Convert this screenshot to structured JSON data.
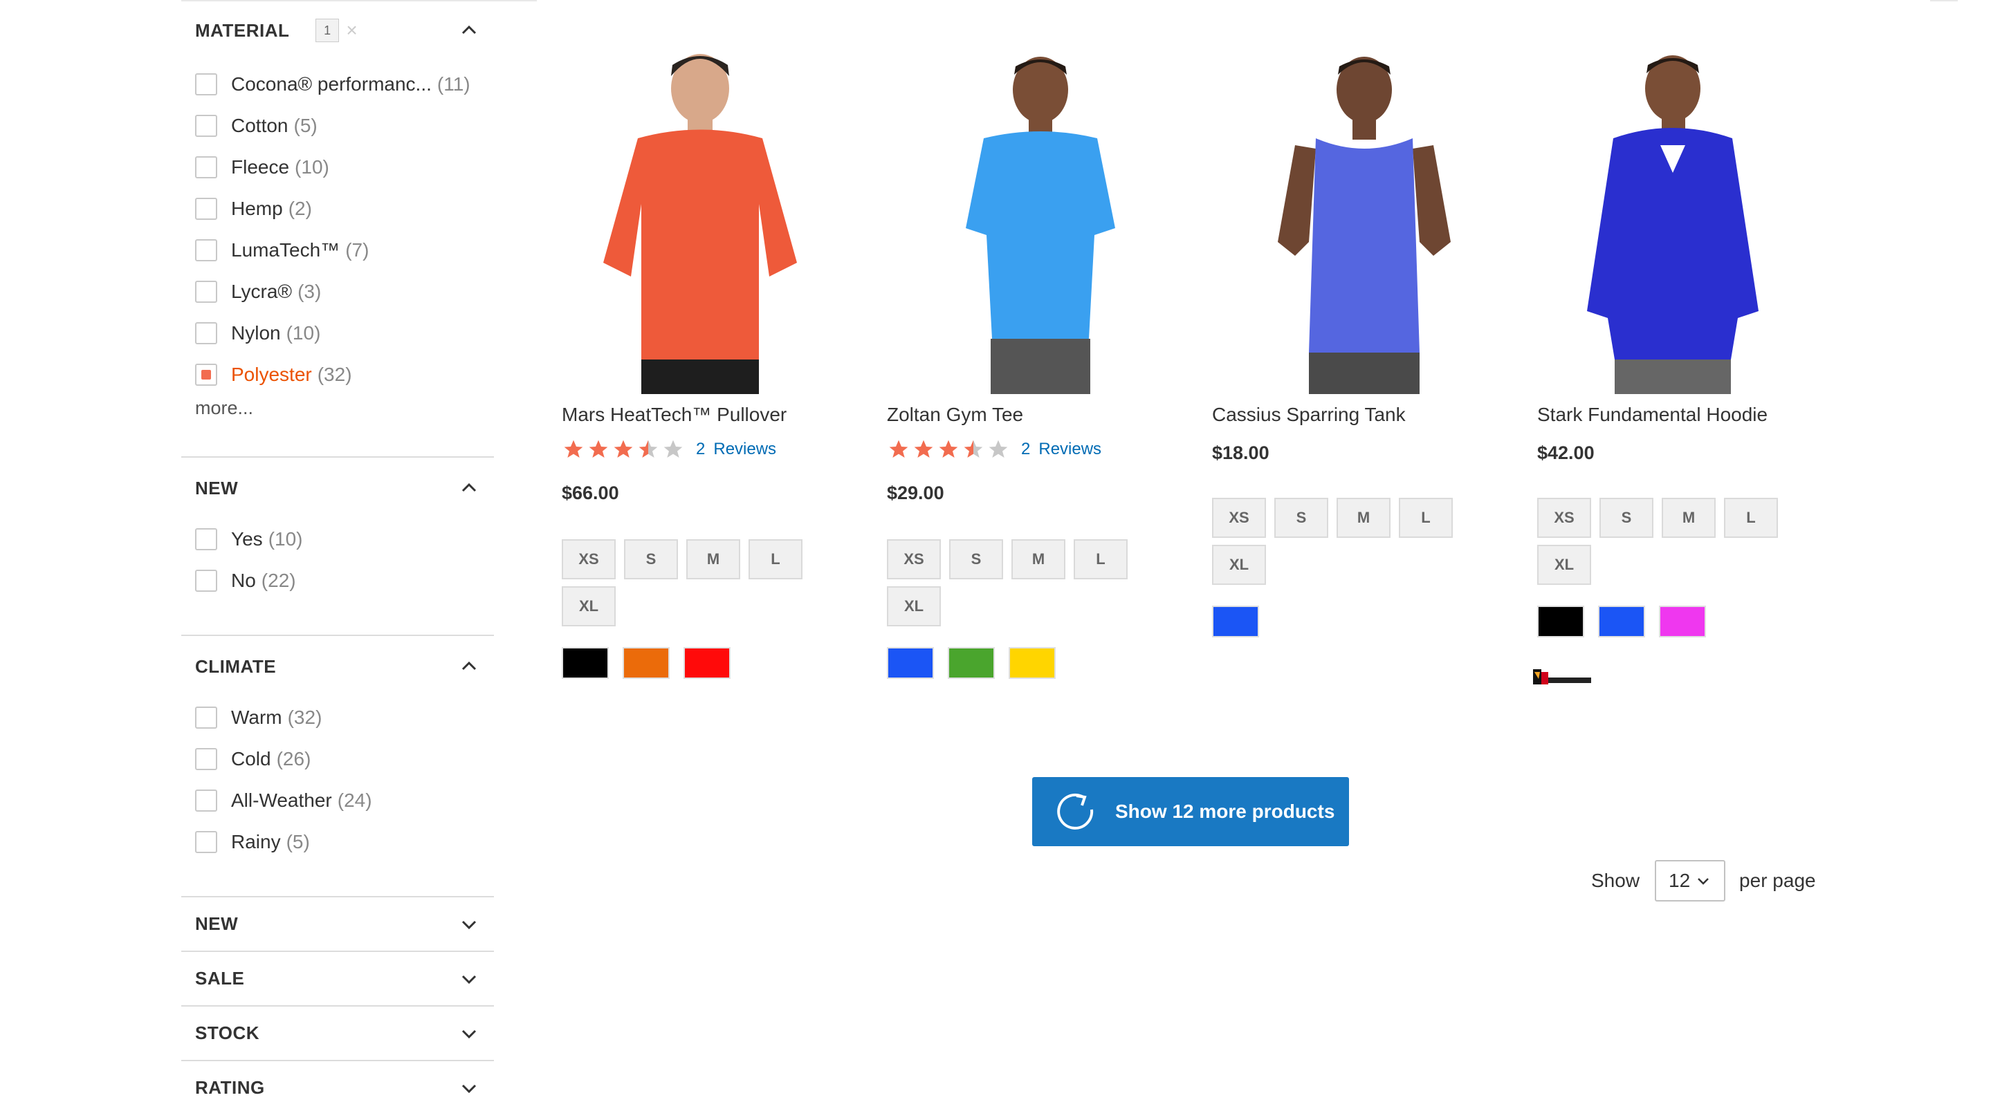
{
  "filters": {
    "material": {
      "title": "MATERIAL",
      "badge": "1",
      "clear": "×",
      "options": [
        {
          "label": "Cocona® performanc...",
          "count": "(11)",
          "checked": false
        },
        {
          "label": "Cotton",
          "count": "(5)",
          "checked": false
        },
        {
          "label": "Fleece",
          "count": "(10)",
          "checked": false
        },
        {
          "label": "Hemp",
          "count": "(2)",
          "checked": false
        },
        {
          "label": "LumaTech™",
          "count": "(7)",
          "checked": false
        },
        {
          "label": "Lycra®",
          "count": "(3)",
          "checked": false
        },
        {
          "label": "Nylon",
          "count": "(10)",
          "checked": false
        },
        {
          "label": "Polyester",
          "count": "(32)",
          "checked": true
        }
      ],
      "more": "more..."
    },
    "new": {
      "title": "NEW",
      "options": [
        {
          "label": "Yes",
          "count": "(10)"
        },
        {
          "label": "No",
          "count": "(22)"
        }
      ]
    },
    "climate": {
      "title": "CLIMATE",
      "options": [
        {
          "label": "Warm",
          "count": "(32)"
        },
        {
          "label": "Cold",
          "count": "(26)"
        },
        {
          "label": "All-Weather",
          "count": "(24)"
        },
        {
          "label": "Rainy",
          "count": "(5)"
        }
      ]
    },
    "collapsed": [
      "NEW",
      "SALE",
      "STOCK",
      "RATING"
    ]
  },
  "products": [
    {
      "name": "Mars HeatTech™ Pullover",
      "rating": 3.5,
      "reviews_count": "2",
      "reviews_label": "Reviews",
      "price": "$66.00",
      "sizes": [
        "XS",
        "S",
        "M",
        "L",
        "XL"
      ],
      "colors": [
        "#000000",
        "#eb6b0a",
        "#ff0a0a"
      ]
    },
    {
      "name": "Zoltan Gym Tee",
      "rating": 3.5,
      "reviews_count": "2",
      "reviews_label": "Reviews",
      "price": "$29.00",
      "sizes": [
        "XS",
        "S",
        "M",
        "L",
        "XL"
      ],
      "colors": [
        "#1b55f5",
        "#4aa52d",
        "#ffd500"
      ]
    },
    {
      "name": "Cassius Sparring Tank",
      "price": "$18.00",
      "sizes": [
        "XS",
        "S",
        "M",
        "L",
        "XL"
      ],
      "colors": [
        "#1b55f5"
      ]
    },
    {
      "name": "Stark Fundamental Hoodie",
      "price": "$42.00",
      "sizes": [
        "XS",
        "S",
        "M",
        "L",
        "XL"
      ],
      "colors": [
        "#000000",
        "#1b55f5",
        "#ef37ef"
      ]
    }
  ],
  "show_more": {
    "label": "Show 12 more products"
  },
  "toolbar": {
    "show": "Show",
    "limit": "12",
    "per_page": "per page"
  },
  "icons": {
    "expanded": "chevron-up-icon",
    "collapsed": "chevron-down-icon",
    "reload": "reload-icon",
    "star": "star-icon"
  },
  "colors": {
    "accent": "#1979c3",
    "link": "#006bb4",
    "star": "#f26c4f",
    "active_filter": "#eb5202"
  }
}
